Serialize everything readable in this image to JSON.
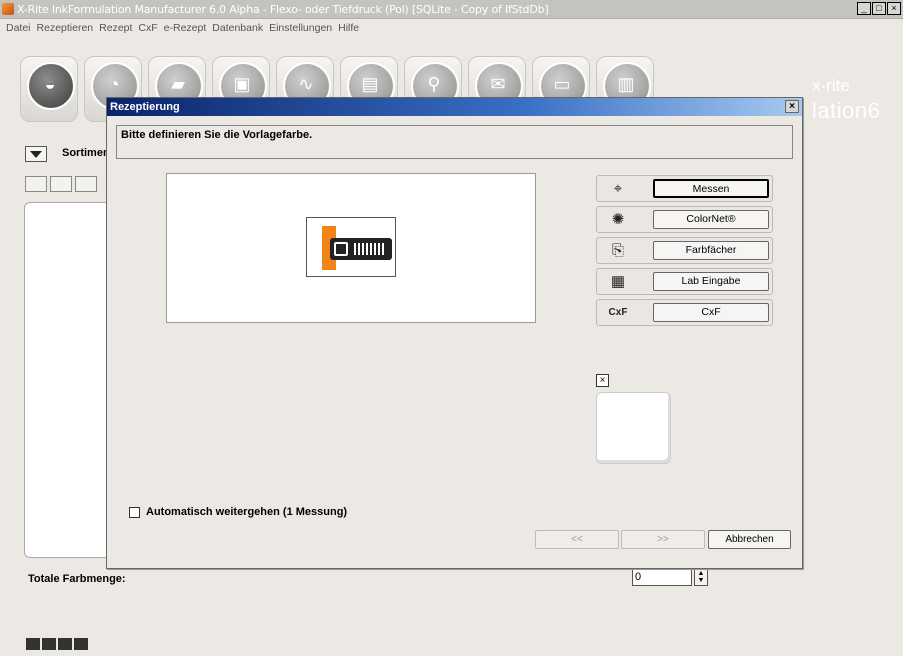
{
  "window": {
    "title": "X-Rite InkFormulation Manufacturer 6.0 Alpha - Flexo- oder Tiefdruck (Pol)  [SQLite - Copy of IfStdDb]",
    "controls": [
      "_",
      "□",
      "×"
    ]
  },
  "menu": [
    "Datei",
    "Rezeptieren",
    "Rezept",
    "CxF",
    "e-Rezept",
    "Datenbank",
    "Einstellungen",
    "Hilfe"
  ],
  "toolbar": {
    "icons": [
      "formulation-icon",
      "shade-icon",
      "open-folder-icon",
      "save-icon",
      "curve-icon",
      "print-icon",
      "dispense-icon",
      "mail-icon",
      "measure-device-icon",
      "statistics-icon"
    ]
  },
  "brand": {
    "logo": "x·rite",
    "product": "lation6"
  },
  "background": {
    "sortiment_label": "Sortimen",
    "total_label": "Totale Farbmenge:",
    "total_value": "0"
  },
  "dialog": {
    "title": "Rezeptierung",
    "close": "×",
    "instruction": "Bitte definieren Sie die Vorlagefarbe.",
    "methods": [
      {
        "icon": "crosshair-icon",
        "glyph": "⌖",
        "label": "Messen"
      },
      {
        "icon": "colornet-icon",
        "glyph": "✺",
        "label": "ColorNet®"
      },
      {
        "icon": "fan-deck-icon",
        "glyph": "⎘",
        "label": "Farbfächer"
      },
      {
        "icon": "calculator-icon",
        "glyph": "▦",
        "label": "Lab Eingabe"
      },
      {
        "icon": "cxf-icon",
        "glyph": "CxF",
        "label": "CxF"
      }
    ],
    "sample_close": "×",
    "auto_continue": "Automatisch weitergehen (1 Messung)",
    "auto_continue_checked": false,
    "prev_label": "<<",
    "next_label": ">>",
    "cancel_label": "Abbrechen"
  }
}
